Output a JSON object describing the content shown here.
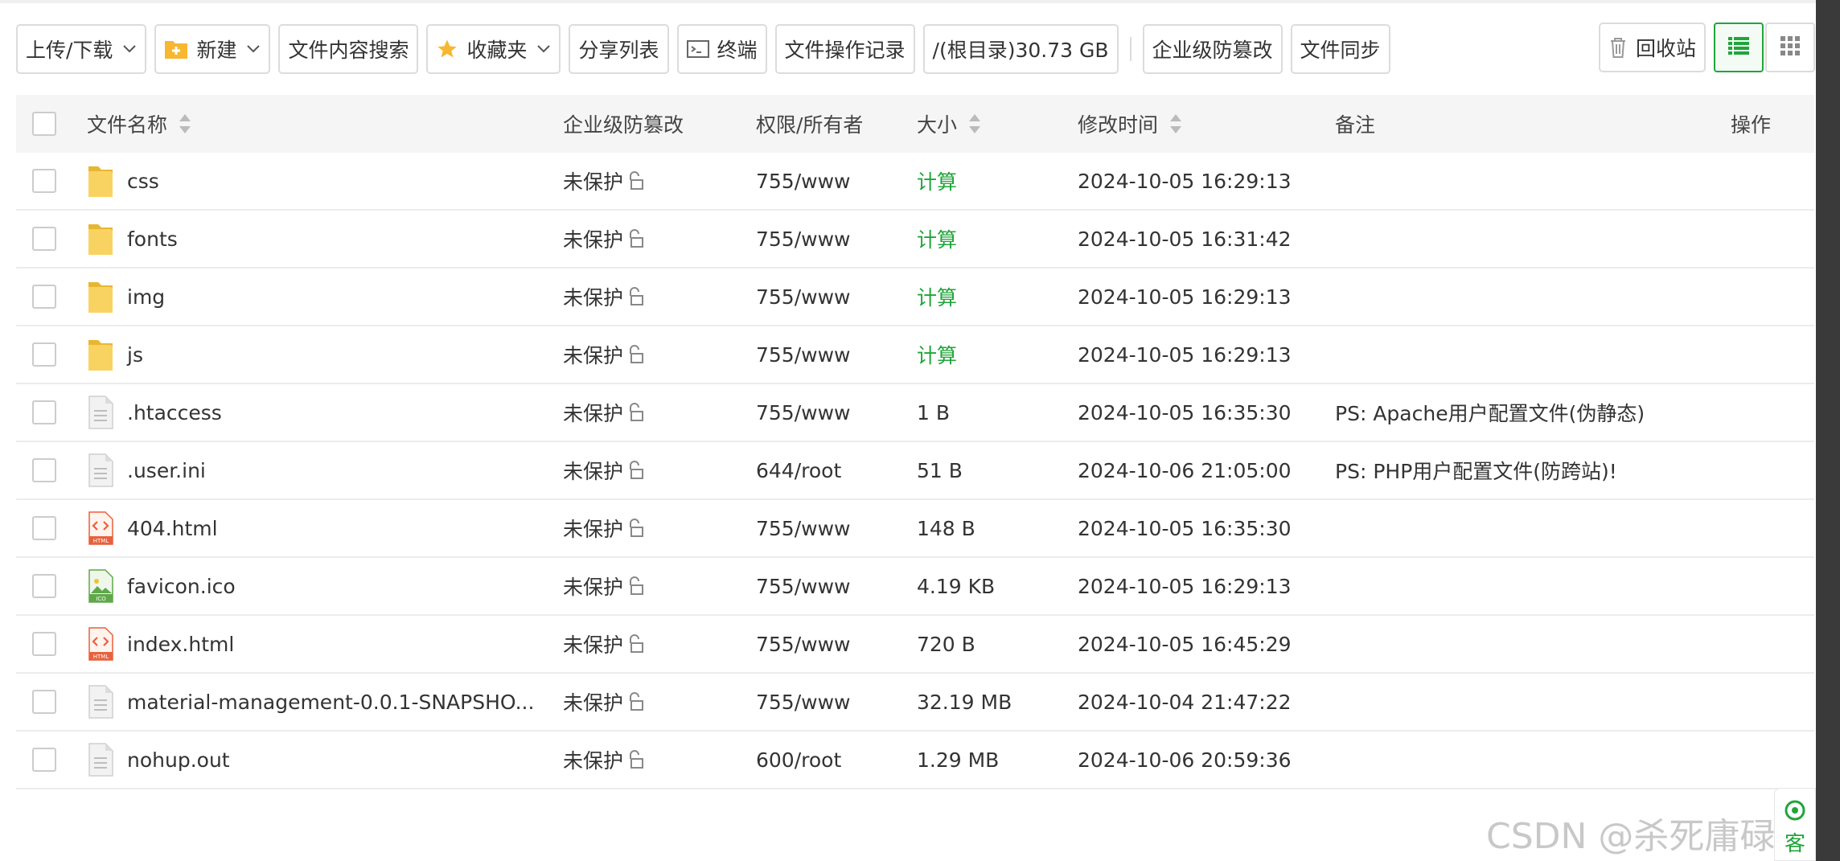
{
  "toolbar": {
    "upload_download": "上传/下载",
    "new": "新建",
    "content_search": "文件内容搜索",
    "favorites": "收藏夹",
    "share_list": "分享列表",
    "terminal": "终端",
    "op_log": "文件操作记录",
    "disk": "/(根目录)30.73 GB",
    "tamper": "企业级防篡改",
    "sync": "文件同步",
    "recycle": "回收站"
  },
  "table": {
    "headers": {
      "name": "文件名称",
      "protect": "企业级防篡改",
      "perm": "权限/所有者",
      "size": "大小",
      "mtime": "修改时间",
      "note": "备注",
      "op": "操作"
    },
    "rows": [
      {
        "name": "css",
        "type": "folder",
        "protect": "未保护",
        "perm": "755/www",
        "size": "计算",
        "mtime": "2024-10-05 16:29:13",
        "note": ""
      },
      {
        "name": "fonts",
        "type": "folder",
        "protect": "未保护",
        "perm": "755/www",
        "size": "计算",
        "mtime": "2024-10-05 16:31:42",
        "note": ""
      },
      {
        "name": "img",
        "type": "folder",
        "protect": "未保护",
        "perm": "755/www",
        "size": "计算",
        "mtime": "2024-10-05 16:29:13",
        "note": ""
      },
      {
        "name": "js",
        "type": "folder",
        "protect": "未保护",
        "perm": "755/www",
        "size": "计算",
        "mtime": "2024-10-05 16:29:13",
        "note": ""
      },
      {
        "name": ".htaccess",
        "type": "text",
        "protect": "未保护",
        "perm": "755/www",
        "size": "1 B",
        "mtime": "2024-10-05 16:35:30",
        "note": "PS: Apache用户配置文件(伪静态)"
      },
      {
        "name": ".user.ini",
        "type": "text",
        "protect": "未保护",
        "perm": "644/root",
        "size": "51 B",
        "mtime": "2024-10-06 21:05:00",
        "note": "PS: PHP用户配置文件(防跨站)!"
      },
      {
        "name": "404.html",
        "type": "html",
        "protect": "未保护",
        "perm": "755/www",
        "size": "148 B",
        "mtime": "2024-10-05 16:35:30",
        "note": ""
      },
      {
        "name": "favicon.ico",
        "type": "ico",
        "protect": "未保护",
        "perm": "755/www",
        "size": "4.19 KB",
        "mtime": "2024-10-05 16:29:13",
        "note": ""
      },
      {
        "name": "index.html",
        "type": "html",
        "protect": "未保护",
        "perm": "755/www",
        "size": "720 B",
        "mtime": "2024-10-05 16:45:29",
        "note": ""
      },
      {
        "name": "material-management-0.0.1-SNAPSHO...",
        "type": "text",
        "protect": "未保护",
        "perm": "755/www",
        "size": "32.19 MB",
        "mtime": "2024-10-04 21:47:22",
        "note": ""
      },
      {
        "name": "nohup.out",
        "type": "text",
        "protect": "未保护",
        "perm": "600/root",
        "size": "1.29 MB",
        "mtime": "2024-10-06 20:59:36",
        "note": ""
      }
    ]
  },
  "watermark": "CSDN @杀死庸碌的我",
  "help_label": "客",
  "colors": {
    "accent": "#20a53a",
    "folder": "#f7c948",
    "html": "#e8613c",
    "ico": "#5fa84a"
  }
}
